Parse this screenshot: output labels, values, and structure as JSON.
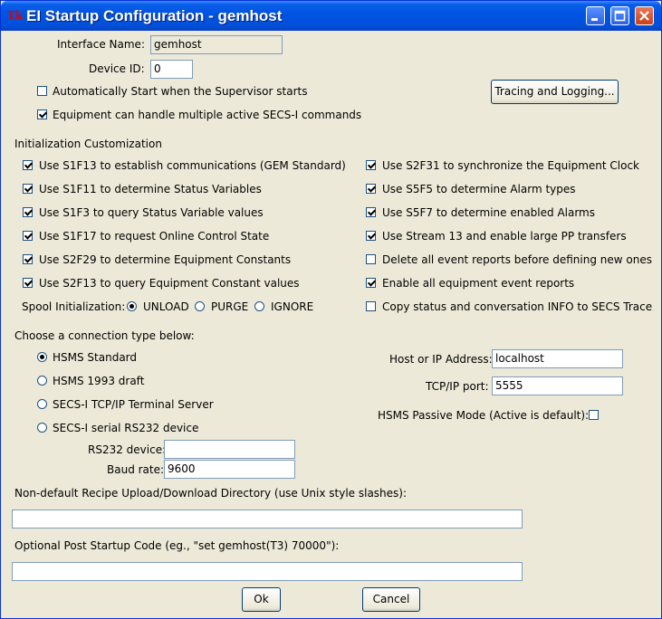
{
  "window": {
    "title": "EI Startup Configuration - gemhost",
    "app_icon": "Tk"
  },
  "top": {
    "interface_name_label": "Interface Name:",
    "interface_name_value": "gemhost",
    "device_id_label": "Device ID:",
    "device_id_value": "0",
    "auto_start_label": "Automatically Start when the Supervisor starts",
    "auto_start_checked": false,
    "multi_secs_label": "Equipment can handle multiple active SECS-I commands",
    "multi_secs_checked": true,
    "tracing_button": "Tracing and Logging..."
  },
  "init": {
    "heading": "Initialization Customization",
    "left": [
      {
        "label": "Use S1F13 to establish communications (GEM Standard)",
        "checked": true
      },
      {
        "label": "Use S1F11 to determine Status Variables",
        "checked": true
      },
      {
        "label": "Use S1F3 to query Status Variable values",
        "checked": true
      },
      {
        "label": "Use S1F17 to request Online Control State",
        "checked": true
      },
      {
        "label": "Use S2F29 to determine Equipment Constants",
        "checked": true
      },
      {
        "label": "Use S2F13 to query Equipment Constant values",
        "checked": true
      }
    ],
    "right": [
      {
        "label": "Use S2F31 to synchronize the Equipment Clock",
        "checked": true
      },
      {
        "label": "Use S5F5 to determine Alarm types",
        "checked": true
      },
      {
        "label": "Use S5F7 to determine enabled Alarms",
        "checked": true
      },
      {
        "label": "Use Stream 13 and enable large PP transfers",
        "checked": true
      },
      {
        "label": "Delete all event reports before defining new ones",
        "checked": false
      },
      {
        "label": "Enable all equipment event reports",
        "checked": true
      },
      {
        "label": "Copy status and conversation INFO to SECS Trace",
        "checked": false
      }
    ],
    "spool_label": "Spool Initialization:",
    "spool_options": [
      "UNLOAD",
      "PURGE",
      "IGNORE"
    ],
    "spool_selected": "UNLOAD"
  },
  "connection": {
    "heading": "Choose a connection type below:",
    "options": [
      "HSMS Standard",
      "HSMS 1993 draft",
      "SECS-I TCP/IP Terminal Server",
      "SECS-I serial RS232 device"
    ],
    "selected": "HSMS Standard",
    "host_label": "Host or IP Address:",
    "host_value": "localhost",
    "port_label": "TCP/IP port:",
    "port_value": "5555",
    "passive_label": "HSMS Passive Mode (Active is default):",
    "passive_checked": false,
    "rs232_label": "RS232 device:",
    "rs232_value": "",
    "baud_label": "Baud rate:",
    "baud_value": "9600"
  },
  "recipe": {
    "label": "Non-default Recipe Upload/Download Directory (use Unix style slashes):",
    "value": ""
  },
  "post_code": {
    "label": "Optional Post Startup Code (eg., \"set gemhost(T3) 70000\"):",
    "value": ""
  },
  "buttons": {
    "ok": "Ok",
    "cancel": "Cancel"
  }
}
